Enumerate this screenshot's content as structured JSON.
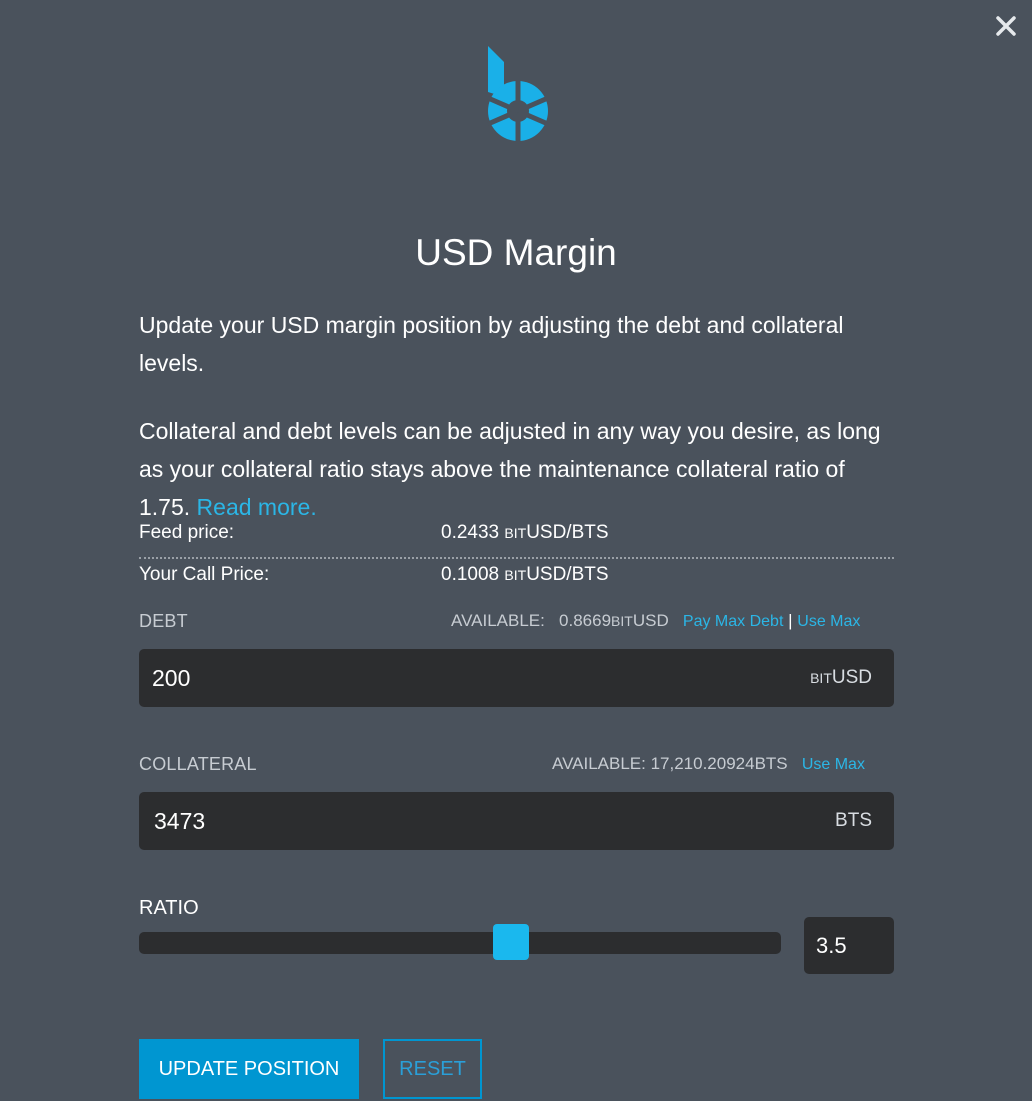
{
  "modal": {
    "title": "USD Margin",
    "intro": "Update your USD margin position by adjusting the debt and collateral levels.",
    "description": "Collateral and debt levels can be adjusted in any way you desire, as long as your collateral ratio stays above the maintenance collateral ratio of 1.75.",
    "read_more": "Read more."
  },
  "feed": {
    "label": "Feed price:",
    "value": "0.2433",
    "unit_prefix": "BIT",
    "unit": "USD/BTS"
  },
  "call": {
    "label": "Your Call Price:",
    "value": "0.1008",
    "unit_prefix": "BIT",
    "unit": "USD/BTS"
  },
  "debt": {
    "label": "DEBT",
    "available_label": "AVAILABLE:",
    "available_value": "0.8669",
    "available_prefix": "BIT",
    "available_unit": "USD",
    "pay_max_debt": "Pay Max Debt",
    "separator": "|",
    "use_max": "Use Max",
    "value": "200",
    "unit_prefix": "BIT",
    "unit": "USD"
  },
  "collateral": {
    "label": "COLLATERAL",
    "available": "AVAILABLE: 17,210.20924BTS",
    "use_max": "Use Max",
    "value": "3473",
    "unit": "BTS"
  },
  "ratio": {
    "label": "RATIO",
    "value": "3.5",
    "slider_fraction": 0.58
  },
  "actions": {
    "update": "UPDATE POSITION",
    "reset": "RESET"
  },
  "colors": {
    "background": "#4a525c",
    "accent": "#0096d1",
    "link": "#2bb6e6",
    "input_bg": "#2c2d2f"
  }
}
